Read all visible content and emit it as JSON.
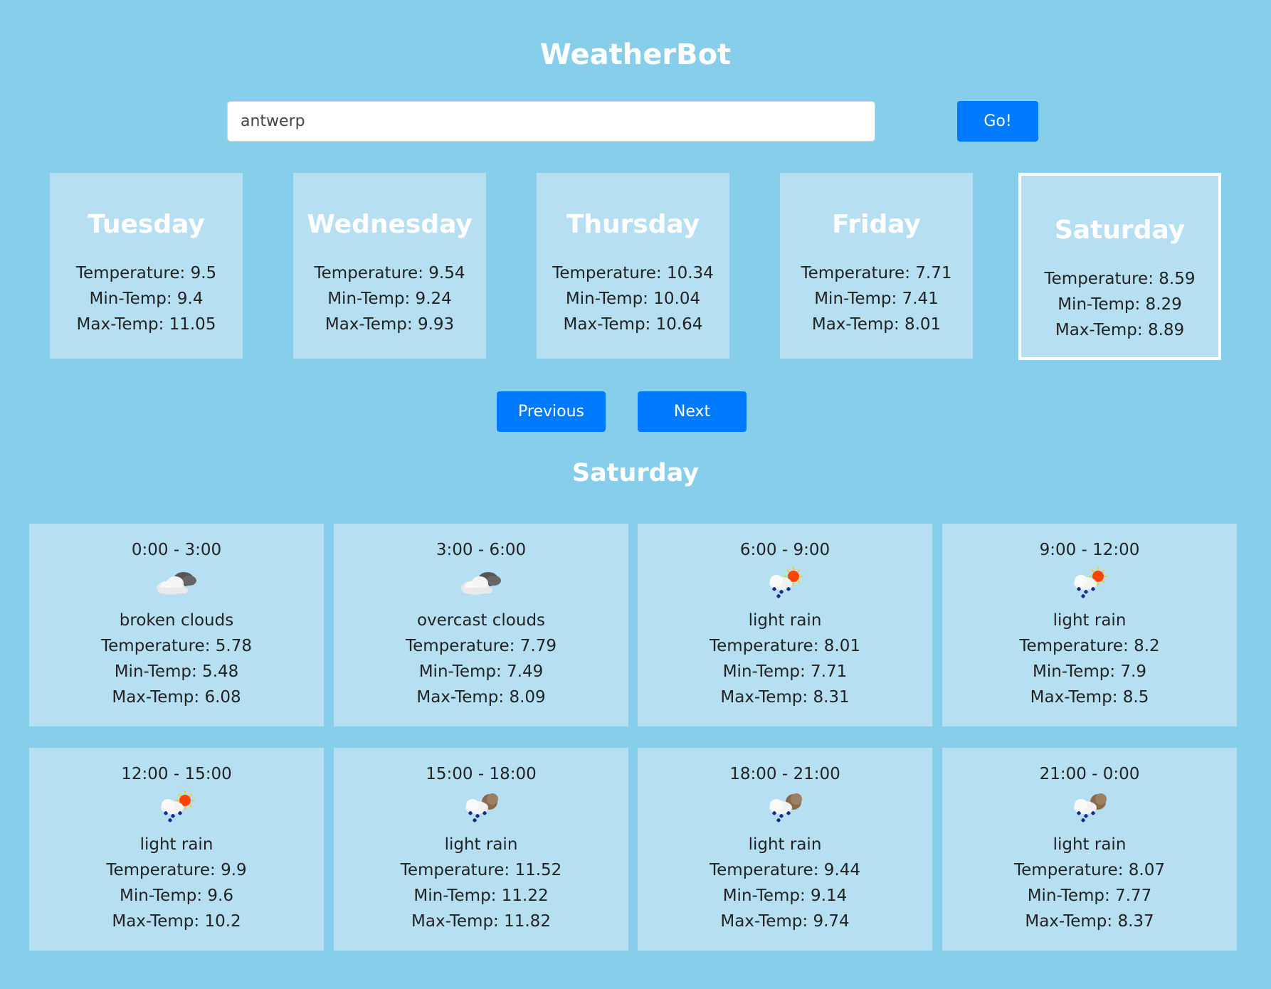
{
  "header": {
    "title": "WeatherBot"
  },
  "search": {
    "value": "antwerp",
    "go_label": "Go!"
  },
  "days": [
    {
      "name": "Tuesday",
      "temperature": "Temperature: 9.5",
      "min": "Min-Temp: 9.4",
      "max": "Max-Temp: 11.05",
      "selected": false
    },
    {
      "name": "Wednesday",
      "temperature": "Temperature: 9.54",
      "min": "Min-Temp: 9.24",
      "max": "Max-Temp: 9.93",
      "selected": false
    },
    {
      "name": "Thursday",
      "temperature": "Temperature: 10.34",
      "min": "Min-Temp: 10.04",
      "max": "Max-Temp: 10.64",
      "selected": false
    },
    {
      "name": "Friday",
      "temperature": "Temperature: 7.71",
      "min": "Min-Temp: 7.41",
      "max": "Max-Temp: 8.01",
      "selected": false
    },
    {
      "name": "Saturday",
      "temperature": "Temperature: 8.59",
      "min": "Min-Temp: 8.29",
      "max": "Max-Temp: 8.89",
      "selected": true
    }
  ],
  "pager": {
    "previous_label": "Previous",
    "next_label": "Next"
  },
  "selected_day": {
    "title": "Saturday"
  },
  "slots": [
    {
      "time": "0:00 - 3:00",
      "icon": "cloud-icon",
      "desc": "broken clouds",
      "temperature": "Temperature: 5.78",
      "min": "Min-Temp: 5.48",
      "max": "Max-Temp: 6.08"
    },
    {
      "time": "3:00 - 6:00",
      "icon": "cloud-icon",
      "desc": "overcast clouds",
      "temperature": "Temperature: 7.79",
      "min": "Min-Temp: 7.49",
      "max": "Max-Temp: 8.09"
    },
    {
      "time": "6:00 - 9:00",
      "icon": "rain-sun-icon",
      "desc": "light rain",
      "temperature": "Temperature: 8.01",
      "min": "Min-Temp: 7.71",
      "max": "Max-Temp: 8.31"
    },
    {
      "time": "9:00 - 12:00",
      "icon": "rain-sun-icon",
      "desc": "light rain",
      "temperature": "Temperature: 8.2",
      "min": "Min-Temp: 7.9",
      "max": "Max-Temp: 8.5"
    },
    {
      "time": "12:00 - 15:00",
      "icon": "rain-sun-icon",
      "desc": "light rain",
      "temperature": "Temperature: 9.9",
      "min": "Min-Temp: 9.6",
      "max": "Max-Temp: 10.2"
    },
    {
      "time": "15:00 - 18:00",
      "icon": "rain-moon-icon",
      "desc": "light rain",
      "temperature": "Temperature: 11.52",
      "min": "Min-Temp: 11.22",
      "max": "Max-Temp: 11.82"
    },
    {
      "time": "18:00 - 21:00",
      "icon": "rain-moon-icon",
      "desc": "light rain",
      "temperature": "Temperature: 9.44",
      "min": "Min-Temp: 9.14",
      "max": "Max-Temp: 9.74"
    },
    {
      "time": "21:00 - 0:00",
      "icon": "rain-moon-icon",
      "desc": "light rain",
      "temperature": "Temperature: 8.07",
      "min": "Min-Temp: 7.77",
      "max": "Max-Temp: 8.37"
    }
  ],
  "colors": {
    "background": "#87CEEB",
    "card": "#B6E0F2",
    "button": "#007BFF"
  }
}
